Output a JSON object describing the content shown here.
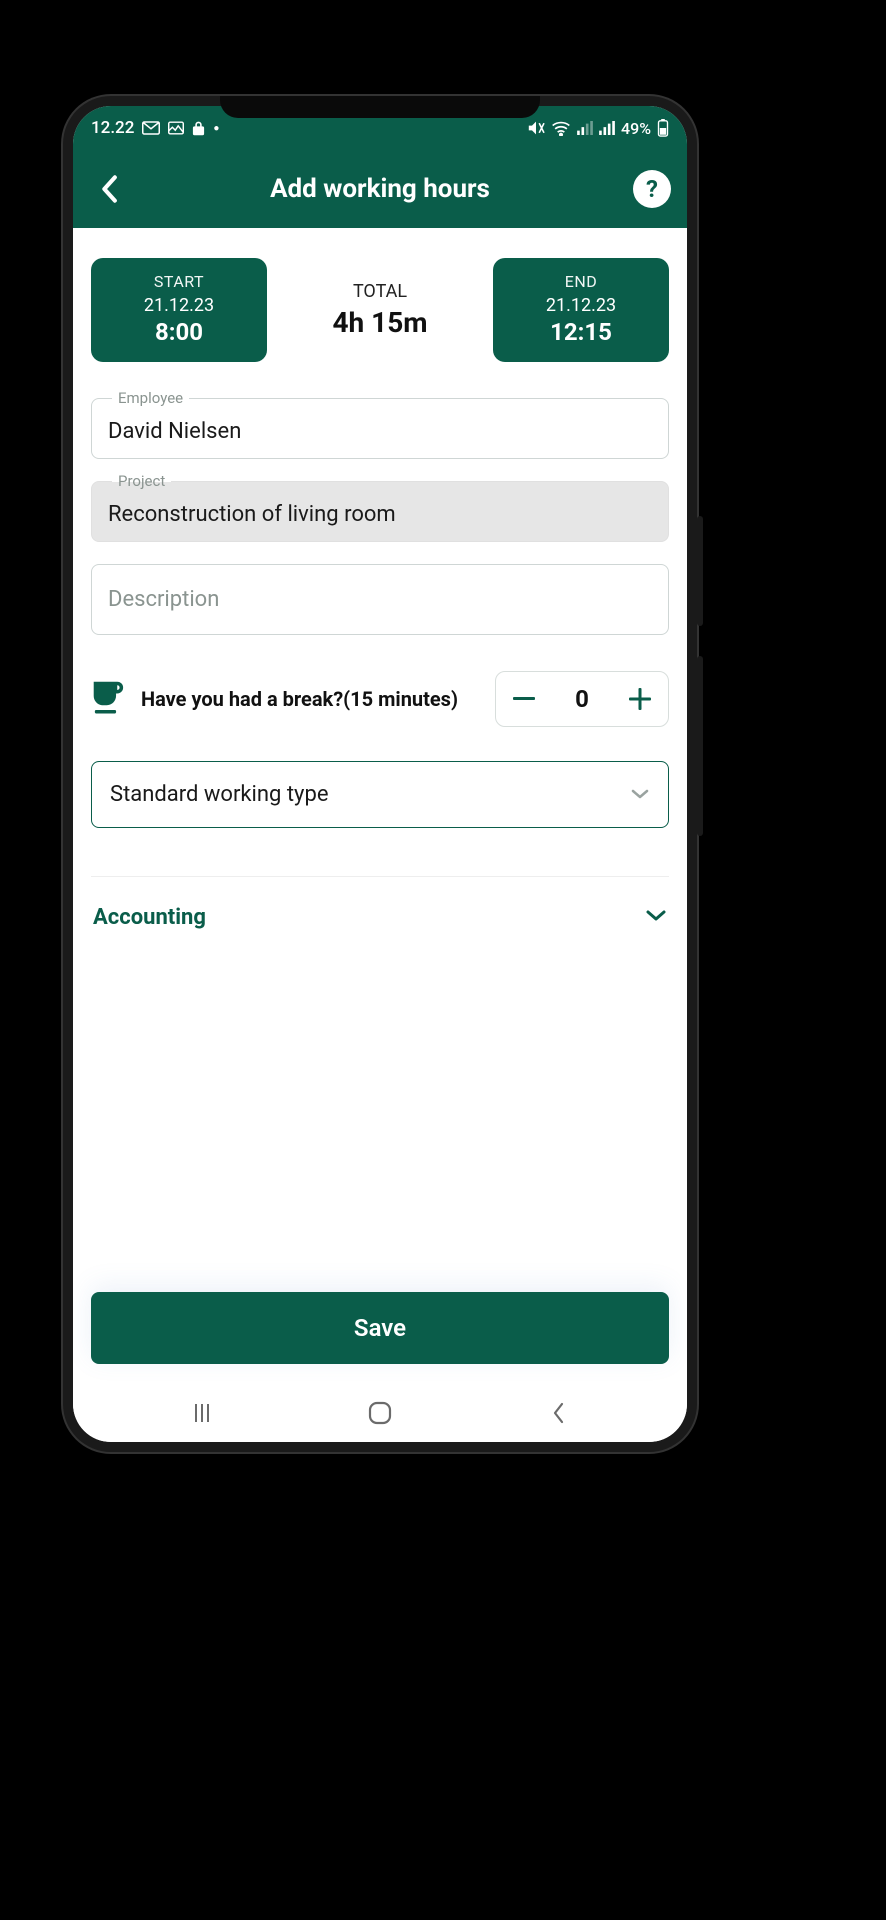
{
  "status": {
    "time": "12.22",
    "battery_pct": "49%"
  },
  "header": {
    "title": "Add working hours"
  },
  "times": {
    "start_label": "START",
    "start_date": "21.12.23",
    "start_time": "8:00",
    "end_label": "END",
    "end_date": "21.12.23",
    "end_time": "12:15",
    "total_label": "TOTAL",
    "total_value": "4h 15m"
  },
  "fields": {
    "employee_label": "Employee",
    "employee_value": "David Nielsen",
    "project_label": "Project",
    "project_value": "Reconstruction of living room",
    "description_placeholder": "Description"
  },
  "break": {
    "text": "Have you had a break?(15 minutes)",
    "count": "0"
  },
  "working_type": {
    "selected": "Standard working type"
  },
  "sections": {
    "accounting": "Accounting"
  },
  "actions": {
    "save": "Save"
  }
}
